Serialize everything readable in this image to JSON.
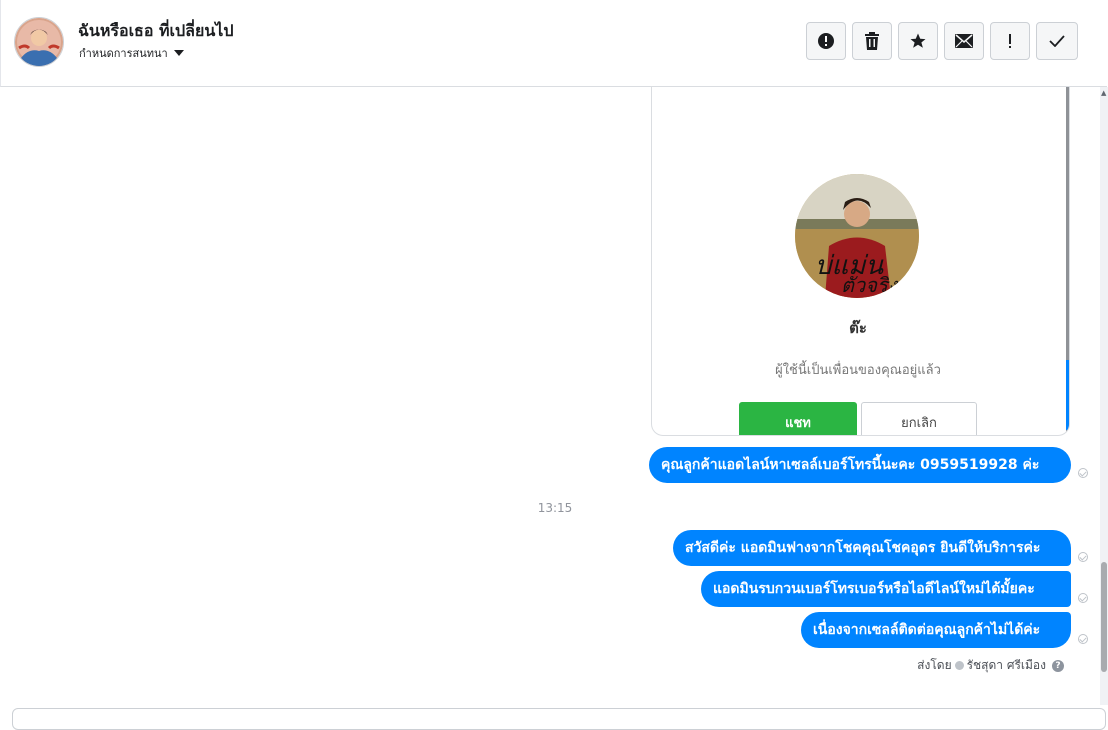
{
  "header": {
    "title": "ฉันหรือเธอ ที่เปลี่ยนไป",
    "subtitle": "กำหนดการสนทนา",
    "avatar_icon": "user-avatar",
    "actions": [
      {
        "name": "spam-button",
        "icon": "alert-circle-icon"
      },
      {
        "name": "delete-button",
        "icon": "trash-icon"
      },
      {
        "name": "star-button",
        "icon": "star-icon"
      },
      {
        "name": "mark-unread-button",
        "icon": "envelope-icon"
      },
      {
        "name": "flag-button",
        "icon": "exclamation-icon"
      },
      {
        "name": "done-button",
        "icon": "checkmark-icon"
      }
    ]
  },
  "card": {
    "photo_icon": "profile-photo",
    "name": "ต๊ะ",
    "description": "ผู้ใช้นี้เป็นเพื่อนของคุณอยู่แล้ว",
    "chat_button": "แชท",
    "cancel_button": "ยกเลิก"
  },
  "messages": {
    "m1": "คุณลูกค้าแอดไลน์หาเซลล์เบอร์โทรนี้นะคะ  0959519928   ค่ะ",
    "m2": "สวัสดีค่ะ แอดมินฟางจากโชคคุณโชคอุดร ยินดีให้บริการค่ะ",
    "m3": "แอดมินรบกวนเบอร์โทรเบอร์หรือไอดีไลน์ใหม่ได้มั้ยคะ",
    "m4": "เนื่องจากเซลล์ติดต่อคุณลูกค้าไม่ได้ค่ะ"
  },
  "timestamp": "13:15",
  "sent_by": {
    "prefix": "ส่งโดย",
    "name": "รัชสุดา ศรีเมือง"
  },
  "colors": {
    "bubble": "#0084ff",
    "chat_button": "#2bb543"
  }
}
